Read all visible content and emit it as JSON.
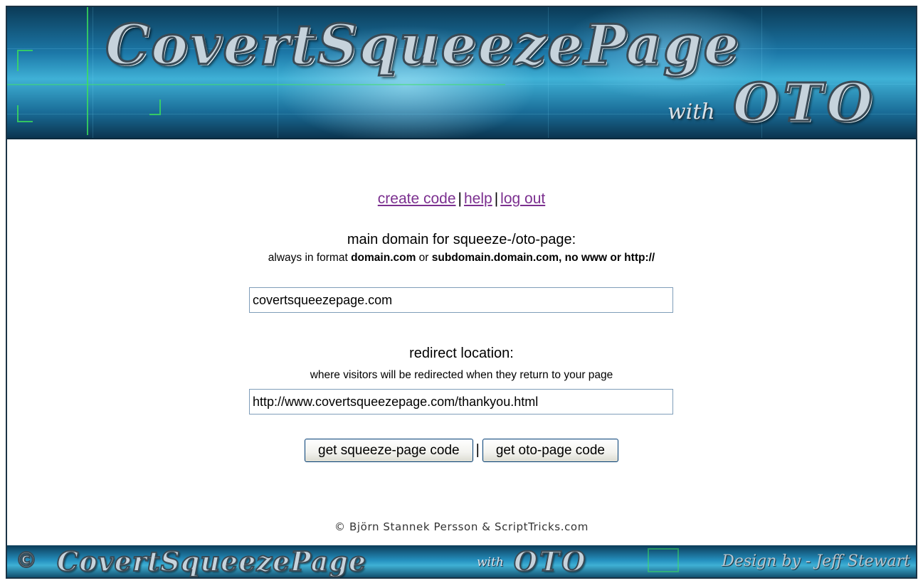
{
  "header": {
    "logo_text": "CovertSqueezePage",
    "with_text": "with",
    "oto_text": "OTO"
  },
  "nav": {
    "create_code": "create code",
    "separator": "|",
    "help": "help",
    "log_out": "log out"
  },
  "form": {
    "domain_label": "main domain for squeeze-/oto-page:",
    "domain_hint_prefix": "always in format ",
    "domain_hint_bold1": "domain.com",
    "domain_hint_or": " or ",
    "domain_hint_bold2": "subdomain.domain.com",
    "domain_hint_suffix": ", no www or http://",
    "domain_value": "covertsqueezepage.com",
    "redirect_label": "redirect location:",
    "redirect_hint": "where visitors will be redirected when they return to your page",
    "redirect_value": "http://www.covertsqueezepage.com/thankyou.html",
    "squeeze_button": "get squeeze-page code",
    "button_separator": "|",
    "oto_button": "get oto-page code"
  },
  "copyright": "© Björn Stannek Persson & ScriptTricks.com",
  "footer": {
    "copyright_symbol": "©",
    "logo_text": "CovertSqueezePage",
    "with_text": "with",
    "oto_text": "OTO",
    "design_credit": "Design by - Jeff Stewart"
  },
  "colors": {
    "link": "#7b2f8f",
    "banner": "#1c78a8",
    "input_border": "#7f9db9"
  }
}
